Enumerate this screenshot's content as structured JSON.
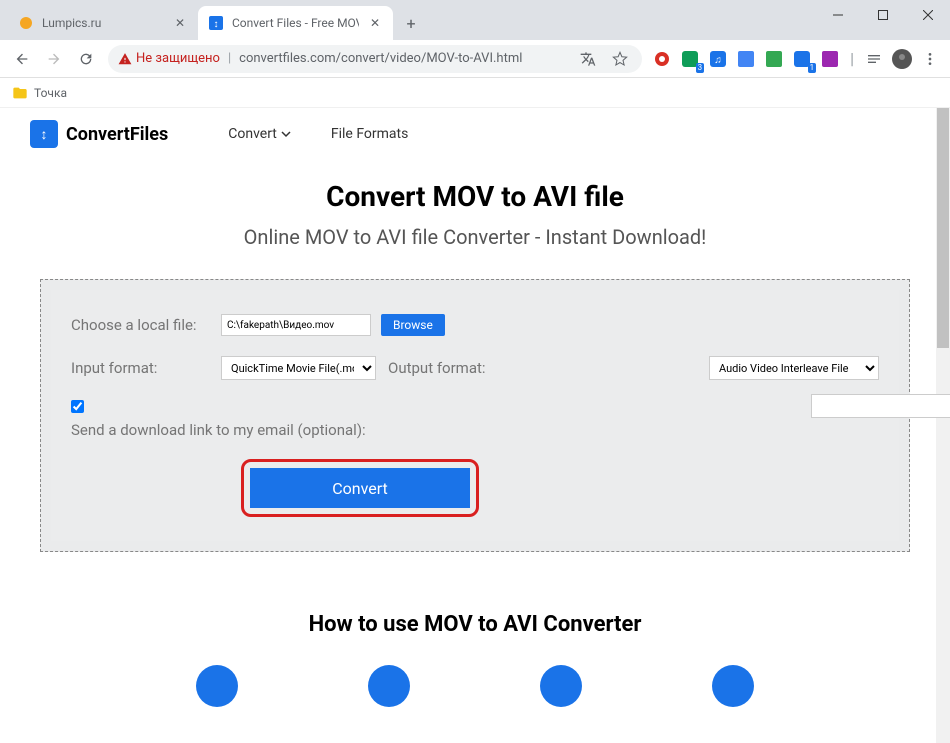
{
  "tabs": [
    {
      "title": "Lumpics.ru",
      "favicon_color": "#f5a623"
    },
    {
      "title": "Convert Files - Free MOV to AVI c",
      "favicon_color": "#1a73e8"
    }
  ],
  "toolbar": {
    "security_label": "Не защищено",
    "url": "convertfiles.com/convert/video/MOV-to-AVI.html",
    "ext_badges": {
      "green": "3",
      "blue": "1"
    }
  },
  "bookmarks": {
    "item1": "Точка"
  },
  "site": {
    "brand": "ConvertFiles",
    "nav_convert": "Convert",
    "nav_formats": "File Formats"
  },
  "page": {
    "title": "Convert MOV to AVI file",
    "subtitle": "Online MOV to AVI file Converter - Instant Download!"
  },
  "form": {
    "choose_label": "Choose a local file:",
    "file_value": "C:\\fakepath\\Видео.mov",
    "browse_label": "Browse",
    "input_format_label": "Input format:",
    "input_format_value": "QuickTime Movie File(.mov",
    "output_format_label": "Output format:",
    "output_format_value": "Audio Video Interleave File",
    "email_label": "Send a download link to my email (optional):",
    "convert_label": "Convert"
  },
  "howto": "How to use MOV to AVI Converter"
}
